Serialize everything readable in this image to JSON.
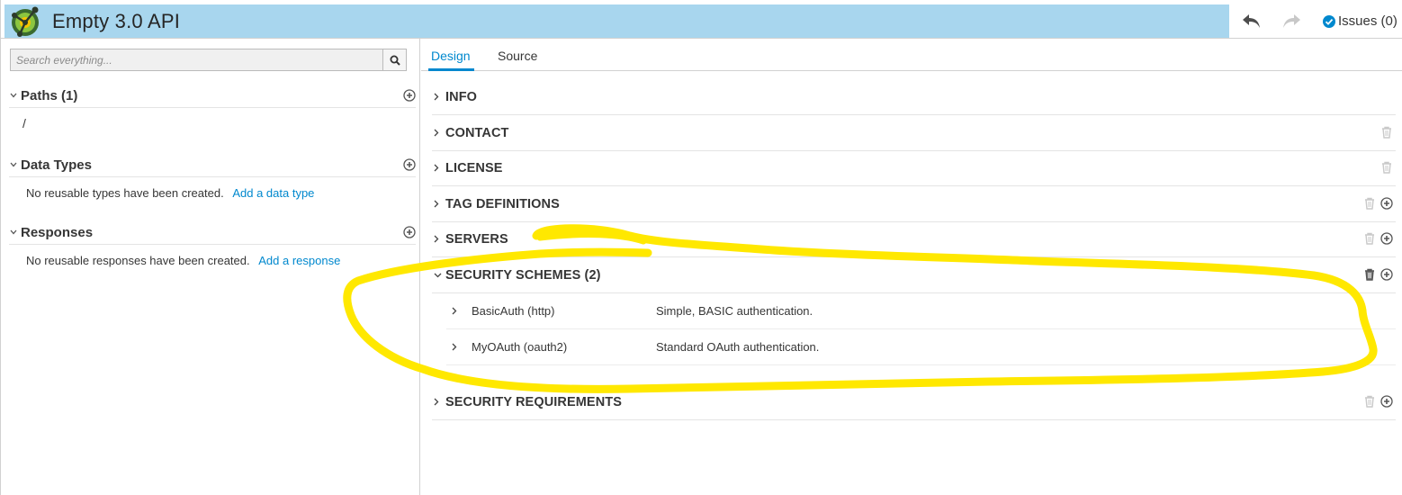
{
  "header": {
    "title": "Empty 3.0 API",
    "issues_label": "Issues (0)",
    "colors": {
      "title_bar": "#a8d6ee",
      "accent": "#0088ce",
      "annotation": "#ffe800"
    }
  },
  "left": {
    "search": {
      "placeholder": "Search everything..."
    },
    "sections": {
      "paths": {
        "title": "Paths (1)",
        "items": [
          "/"
        ]
      },
      "data_types": {
        "title": "Data Types",
        "empty_text": "No reusable types have been created.",
        "add_link": "Add a data type"
      },
      "responses": {
        "title": "Responses",
        "empty_text": "No reusable responses have been created.",
        "add_link": "Add a response"
      }
    }
  },
  "tabs": {
    "design": "Design",
    "source": "Source"
  },
  "main": {
    "sections": {
      "info": "INFO",
      "contact": "CONTACT",
      "license": "LICENSE",
      "tag_definitions": "TAG DEFINITIONS",
      "servers": "SERVERS",
      "security_schemes": "SECURITY SCHEMES (2)",
      "security_requirements": "SECURITY REQUIREMENTS"
    },
    "security_schemes": [
      {
        "name": "BasicAuth (http)",
        "description": "Simple, BASIC authentication."
      },
      {
        "name": "MyOAuth (oauth2)",
        "description": "Standard OAuth authentication."
      }
    ]
  },
  "icons": {
    "logo": "apicurio-logo",
    "undo": "undo-icon",
    "redo": "redo-icon",
    "issues": "check-circle-icon",
    "search": "search-icon",
    "add": "plus-circle-icon",
    "delete": "trash-icon",
    "expand": "chevron-right-icon",
    "collapse": "chevron-down-icon"
  }
}
